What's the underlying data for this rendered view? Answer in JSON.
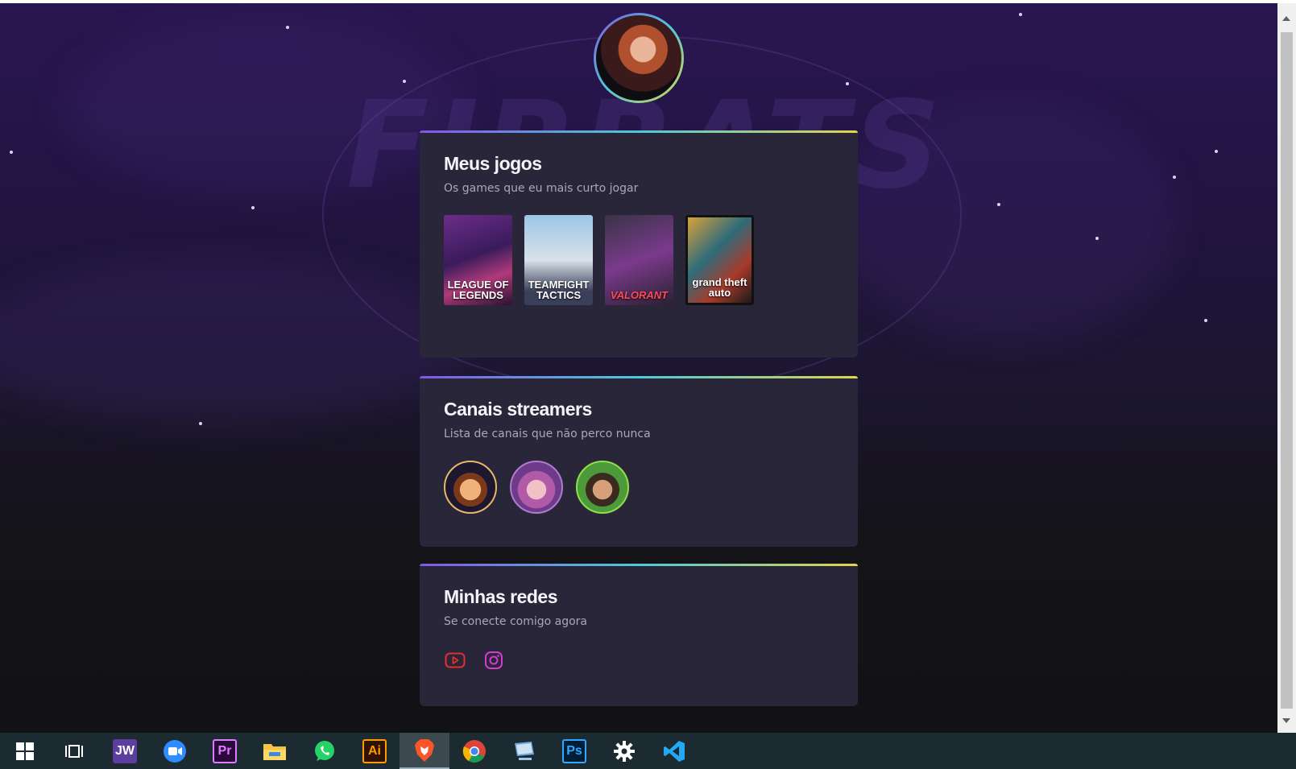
{
  "profile": {
    "avatar_icon": "profile-photo"
  },
  "sections": {
    "games": {
      "title": "Meus jogos",
      "subtitle": "Os games que eu mais curto jogar",
      "items": [
        {
          "label": "LEAGUE OF LEGENDS"
        },
        {
          "label": "TEAMFIGHT TACTICS"
        },
        {
          "label": "VALORANT"
        },
        {
          "label": "grand theft auto"
        }
      ]
    },
    "streamers": {
      "title": "Canais streamers",
      "subtitle": "Lista de canais que não perco nunca"
    },
    "socials": {
      "title": "Minhas redes",
      "subtitle": "Se conecte comigo agora",
      "links": [
        {
          "icon": "youtube-icon",
          "color": "#e0302e"
        },
        {
          "icon": "instagram-icon",
          "color": "#d53bd1"
        }
      ]
    }
  },
  "taskbar": {
    "items": [
      {
        "icon": "windows-start-icon"
      },
      {
        "icon": "task-view-icon"
      },
      {
        "label": "JW",
        "color": "#5b3e9e"
      },
      {
        "icon": "zoom-icon",
        "color": "#2d8cff"
      },
      {
        "label": "Pr",
        "color": "#2a0a3a"
      },
      {
        "icon": "file-explorer-icon",
        "color": "#f4c542"
      },
      {
        "icon": "whatsapp-icon",
        "color": "#25d366"
      },
      {
        "label": "Ai",
        "color": "#2f1300"
      },
      {
        "icon": "brave-browser-icon",
        "color": "#fb542b"
      },
      {
        "icon": "chrome-icon"
      },
      {
        "icon": "remote-desktop-icon"
      },
      {
        "label": "Ps",
        "color": "#001e36"
      },
      {
        "icon": "settings-gear-icon"
      },
      {
        "icon": "vscode-icon",
        "color": "#23a9f2"
      }
    ]
  },
  "colors": {
    "accent_gradient": [
      "#8257e6",
      "#4ec9d8",
      "#e0d44c"
    ],
    "card": "#29263a"
  }
}
